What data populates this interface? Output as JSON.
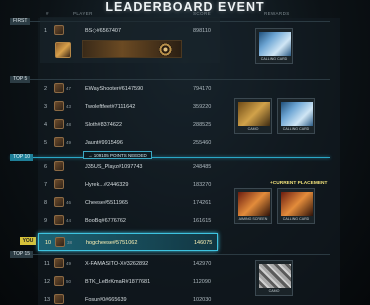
{
  "header": {
    "title": "LEADERBOARD EVENT",
    "col_number": "#",
    "col_player": "PLAYER",
    "col_score": "SCORE",
    "col_rewards": "REWARDS"
  },
  "sections": {
    "first": "FIRST",
    "top5": "TOP 5",
    "top10": "TOP 10",
    "top15": "TOP 15"
  },
  "points_needed": "→ 109105 POINTS NEEDED",
  "current_placement": "+CURRENT PLACEMENT",
  "you_tag": "YOU",
  "rows": [
    {
      "rank": "1",
      "lvl": "",
      "name": "BS◇#6567407",
      "score": "898110"
    },
    {
      "rank": "2",
      "lvl": "47",
      "name": "EWayShooter#6147590",
      "score": "794170"
    },
    {
      "rank": "3",
      "lvl": "43",
      "name": "Twoleftfeet#7111642",
      "score": "359220"
    },
    {
      "rank": "4",
      "lvl": "48",
      "name": "Sloth#8374622",
      "score": "288525"
    },
    {
      "rank": "5",
      "lvl": "49",
      "name": "Jaunt#9915496",
      "score": "255460"
    },
    {
      "rank": "6",
      "lvl": "",
      "name": "J35US_Playz#1097743",
      "score": "248485"
    },
    {
      "rank": "7",
      "lvl": "",
      "name": "Hyrek...#2446329",
      "score": "183270"
    },
    {
      "rank": "8",
      "lvl": "46",
      "name": "Cheese#5511965",
      "score": "174261"
    },
    {
      "rank": "9",
      "lvl": "44",
      "name": "BooBq#6776762",
      "score": "161615"
    },
    {
      "rank": "10",
      "lvl": "38",
      "name": "hogcheese#5751062",
      "score": "146075"
    },
    {
      "rank": "11",
      "lvl": "49",
      "name": "X-FAMASITO-X#3262892",
      "score": "142970"
    },
    {
      "rank": "12",
      "lvl": "50",
      "name": "BTK_LeBrKmaR#1877681",
      "score": "112090"
    },
    {
      "rank": "13",
      "lvl": "",
      "name": "Fosur#0#665639",
      "score": "102030"
    }
  ],
  "rewards": {
    "first": "CALLING CARD",
    "top5_a": "CAMO",
    "top5_b": "CALLING CARD",
    "top10_a": "AIMING SCREEN",
    "top10_b": "CALLING CARD",
    "top15_a": "CAMO"
  }
}
